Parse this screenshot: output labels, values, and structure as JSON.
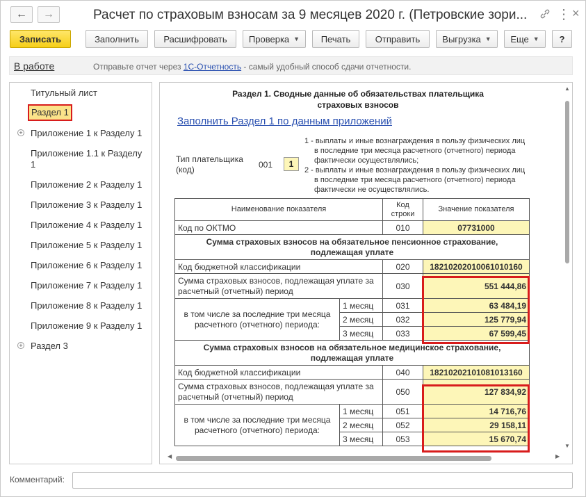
{
  "window": {
    "title": "Расчет по страховым взносам за 9 месяцев 2020 г. (Петровские зори)",
    "title_display": "Расчет по страховым взносам за 9 месяцев 2020 г. (Петровские зори...",
    "back_glyph": "←",
    "forward_glyph": "→",
    "link_glyph": "🔗",
    "menu_glyph": "⋮",
    "close_glyph": "×"
  },
  "toolbar": {
    "save": "Записать",
    "fill": "Заполнить",
    "decode": "Расшифровать",
    "check": "Проверка",
    "print": "Печать",
    "send": "Отправить",
    "export": "Выгрузка",
    "more": "Еще",
    "help": "?"
  },
  "infobar": {
    "status": "В работе",
    "msg_before": "Отправьте отчет через ",
    "msg_link": "1С-Отчетность",
    "msg_after": " - самый удобный способ сдачи отчетности."
  },
  "sidebar": {
    "items": [
      {
        "label": "Титульный лист"
      },
      {
        "label": "Раздел 1"
      },
      {
        "label": "Приложение 1 к Разделу 1"
      },
      {
        "label": "Приложение 1.1 к Разделу 1"
      },
      {
        "label": "Приложение 2 к Разделу 1"
      },
      {
        "label": "Приложение 3 к Разделу 1"
      },
      {
        "label": "Приложение 4 к Разделу 1"
      },
      {
        "label": "Приложение 5 к Разделу 1"
      },
      {
        "label": "Приложение 6 к Разделу 1"
      },
      {
        "label": "Приложение 7 к Разделу 1"
      },
      {
        "label": "Приложение 8 к Разделу 1"
      },
      {
        "label": "Приложение 9 к Разделу 1"
      },
      {
        "label": "Раздел 3"
      }
    ],
    "active_index": 1,
    "expander_glyph": "+"
  },
  "doc": {
    "heading": "Раздел 1. Сводные данные об обязательствах плательщика страховых взносов",
    "fill_link": "Заполнить Раздел 1 по данным приложений",
    "payer_label": "Тип плательщика (код)",
    "payer_code": "001",
    "payer_value": "1",
    "payer_desc_1": "1 - выплаты и иные вознаграждения в пользу физических лиц в последние три месяца расчетного (отчетного) периода фактически осуществлялись;",
    "payer_desc_2": "2 - выплаты и иные вознаграждения в пользу физических лиц в последние три месяца расчетного (отчетного) периода фактически не осуществлялись.",
    "table": {
      "col_name": "Наименование показателя",
      "col_code": "Код строки",
      "col_value": "Значение показателя",
      "oktmo_label": "Код по ОКТМО",
      "oktmo_code": "010",
      "oktmo_value": "07731000",
      "pension_section": "Сумма страховых взносов на обязательное пенсионное страхование, подлежащая уплате",
      "kbk_label": "Код бюджетной классификации",
      "pension_kbk_code": "020",
      "pension_kbk_value": "18210202010061010160",
      "sum_label": "Сумма страховых взносов, подлежащая уплате за расчетный (отчетный) период",
      "pension_sum_code": "030",
      "pension_sum_value": "551 444,86",
      "months_label": "в том числе за последние три месяца расчетного (отчетного) периода:",
      "month1": "1 месяц",
      "month2": "2 месяц",
      "month3": "3 месяц",
      "pension_m1_code": "031",
      "pension_m1_value": "63 484,19",
      "pension_m2_code": "032",
      "pension_m2_value": "125 779,94",
      "pension_m3_code": "033",
      "pension_m3_value": "67 599,45",
      "medical_section": "Сумма страховых взносов на обязательное медицинское страхование, подлежащая уплате",
      "medical_kbk_code": "040",
      "medical_kbk_value": "18210202101081013160",
      "medical_sum_code": "050",
      "medical_sum_value": "127 834,92",
      "medical_m1_code": "051",
      "medical_m1_value": "14 716,76",
      "medical_m2_code": "052",
      "medical_m2_value": "29 158,11",
      "medical_m3_code": "053",
      "medical_m3_value": "15 670,74"
    }
  },
  "comment": {
    "label": "Комментарий:",
    "value": ""
  },
  "colors": {
    "primary_button": "#f6cf18",
    "highlight_fill": "#fdf6b8",
    "annotation_red": "#d81c1c",
    "link_blue": "#2a50b0"
  }
}
